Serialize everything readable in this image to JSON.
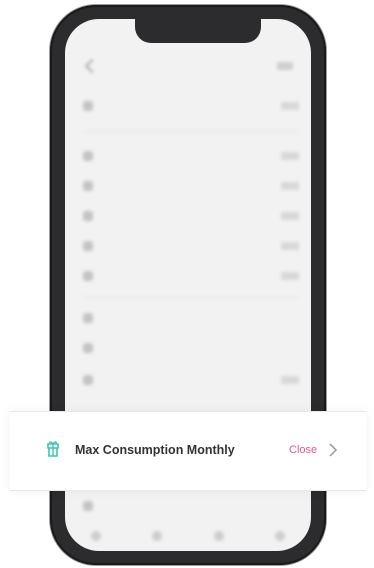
{
  "background_screen": {
    "nav_title": "",
    "rows": [
      {
        "label": "",
        "value": ""
      },
      {
        "label": "",
        "value": ""
      },
      {
        "label": "",
        "value": ""
      },
      {
        "label": "",
        "value": ""
      },
      {
        "label": "",
        "value": ""
      },
      {
        "label": "",
        "value": ""
      },
      {
        "label": "",
        "value": ""
      },
      {
        "label": "",
        "value": ""
      },
      {
        "label": "",
        "value": ""
      },
      {
        "label": "",
        "value": ""
      }
    ]
  },
  "setting_row": {
    "label": "Max Consumption Monthly",
    "value": "Close",
    "icon": "gift-box-icon",
    "chevron": "chevron-right-icon",
    "colors": {
      "icon": "#3bc4b0",
      "value": "#e05a84",
      "label": "#333333"
    }
  }
}
